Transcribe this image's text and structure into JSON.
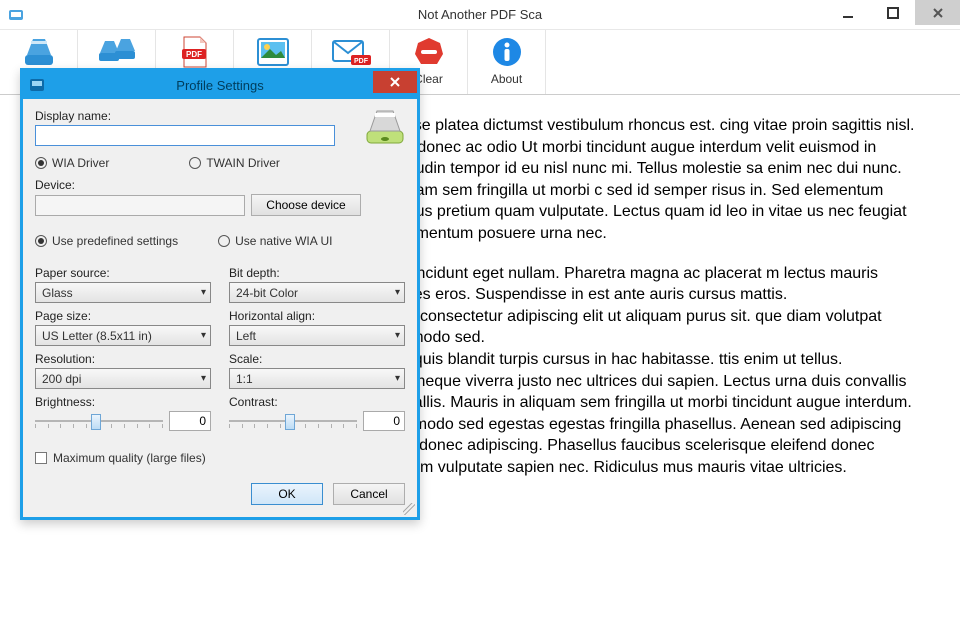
{
  "window": {
    "title": "Not Another PDF Sca"
  },
  "toolbar": {
    "pdf_label": "PDF",
    "clear_label": "Clear",
    "about_label": "About"
  },
  "dialog": {
    "title": "Profile Settings",
    "display_name_label": "Display name:",
    "display_name_value": "",
    "driver_wia": "WIA Driver",
    "driver_twain": "TWAIN Driver",
    "device_label": "Device:",
    "device_value": "",
    "choose_device": "Choose device",
    "use_predefined": "Use predefined settings",
    "use_native": "Use native WIA UI",
    "left": {
      "paper_source_label": "Paper source:",
      "paper_source_value": "Glass",
      "page_size_label": "Page size:",
      "page_size_value": "US Letter (8.5x11 in)",
      "resolution_label": "Resolution:",
      "resolution_value": "200 dpi",
      "brightness_label": "Brightness:",
      "brightness_value": "0"
    },
    "right": {
      "bit_depth_label": "Bit depth:",
      "bit_depth_value": "24-bit Color",
      "halign_label": "Horizontal align:",
      "halign_value": "Left",
      "scale_label": "Scale:",
      "scale_value": "1:1",
      "contrast_label": "Contrast:",
      "contrast_value": "0"
    },
    "max_quality": "Maximum quality (large files)",
    "ok": "OK",
    "cancel": "Cancel"
  },
  "document": {
    "p1": "bitasse platea dictumst vestibulum rhoncus est. cing vitae proin sagittis nisl. Eros donec ac odio Ut morbi tincidunt augue interdum velit euismod in ollicitudin tempor id eu nisl nunc mi. Tellus molestie sa enim nec dui nunc. Aliquam sem fringilla ut morbi c sed id semper risus in. Sed elementum tempus pretium quam vulputate. Lectus quam id leo in vitae us nec feugiat in fermentum posuere urna nec.",
    "p2": "nisl tincidunt eget nullam. Pharetra magna ac placerat m lectus mauris ultrices eros. Suspendisse in est ante auris cursus mattis.\namet consectetur adipiscing elit ut aliquam purus sit. que diam volutpat commodo sed.\nvida quis blandit turpis cursus in hac habitasse. ttis enim ut tellus.\nurna neque viverra justo nec ultrices dui sapien. Lectus urna duis convallis convallis. Mauris in aliquam sem fringilla ut morbi tincidunt augue interdum. Commodo sed egestas egestas fringilla phasellus. Aenean sed adipiscing diam donec adipiscing. Phasellus faucibus scelerisque eleifend donec pretium vulputate sapien nec. Ridiculus mus mauris vitae ultricies."
  }
}
